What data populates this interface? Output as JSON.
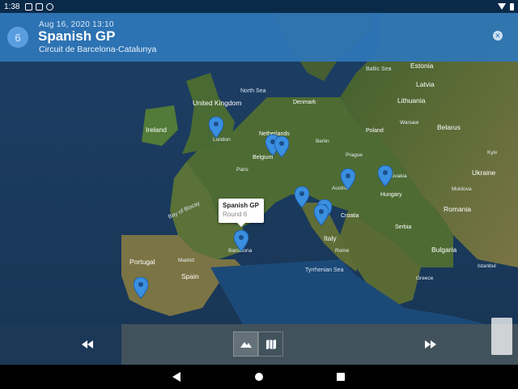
{
  "status_bar": {
    "time": "1:38"
  },
  "header": {
    "round": "6",
    "date": "Aug 16, 2020 13:10",
    "title": "Spanish GP",
    "circuit": "Circuit de Barcelona-Catalunya"
  },
  "map": {
    "countries": [
      "United Kingdom",
      "Ireland",
      "Netherlands",
      "Belgium",
      "Denmark",
      "Poland",
      "Belarus",
      "Ukraine",
      "Romania",
      "Hungary",
      "Serbia",
      "Bulgaria",
      "Croatia",
      "Italy",
      "Spain",
      "Portugal",
      "Latvia",
      "Lithuania",
      "Estonia",
      "Moldova",
      "Greece",
      "Austria",
      "Slovakia"
    ],
    "seas": [
      "North Sea",
      "Baltic Sea",
      "Tyrrhenian Sea",
      "Bay of Biscay"
    ],
    "cities": [
      "London",
      "Paris",
      "Berlin",
      "Prague",
      "Rome",
      "Madrid",
      "Barcelona",
      "Istanbul",
      "Warsaw",
      "Kyiv"
    ],
    "marker_color": "#3a8fe0",
    "markers": [
      "silverstone",
      "zandvoort",
      "spa",
      "austria",
      "hungary",
      "monza",
      "imola",
      "mugello",
      "barcelona",
      "portimao"
    ]
  },
  "popup": {
    "title": "Spanish GP",
    "subtitle": "Round 6"
  },
  "controls": {
    "rewind": "previous-race-icon",
    "forward": "next-race-icon",
    "terrain": "terrain-icon",
    "map_view": "map-icon"
  }
}
